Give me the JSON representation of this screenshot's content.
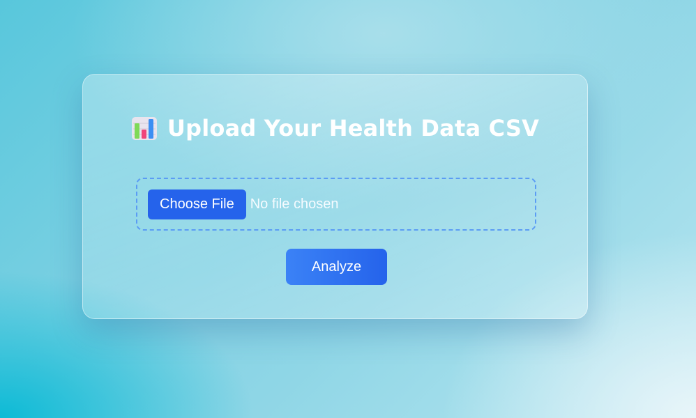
{
  "upload_card": {
    "title": "Upload Your Health Data CSV",
    "title_icon": "bar-chart-icon",
    "file_input": {
      "button_label": "Choose File",
      "status_text": "No file chosen"
    },
    "analyze_label": "Analyze"
  },
  "colors": {
    "primary_button": "#2563eb",
    "dashed_border": "#5b9cf4",
    "title_text": "#ffffff"
  }
}
